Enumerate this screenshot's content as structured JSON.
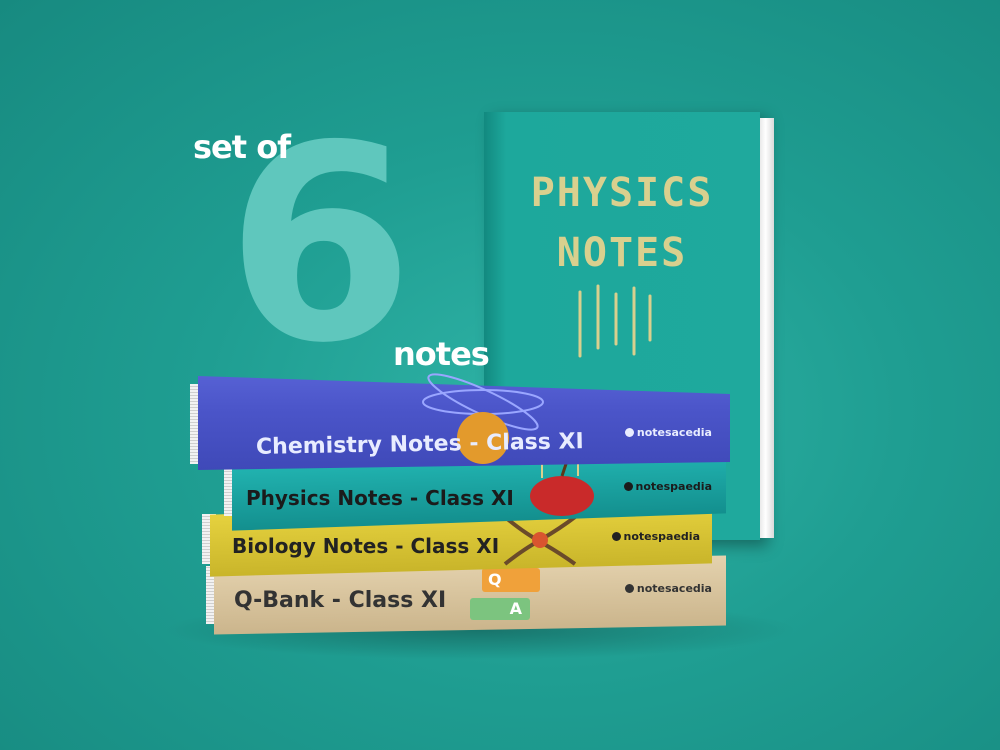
{
  "promo": {
    "prefix": "set of",
    "count": "6",
    "suffix": "notes"
  },
  "standing_book": {
    "title_line1": "PHYSICS",
    "title_line2": "NOTES",
    "cover_color": "#1fa99d"
  },
  "stack": [
    {
      "title": "Chemistry Notes - Class XI",
      "brand": "notesacedia",
      "cover_color": "#4a56c8"
    },
    {
      "title": "Physics Notes - Class XI",
      "brand": "notespaedia",
      "cover_color": "#1aa8a8"
    },
    {
      "title": "Biology Notes - Class XI",
      "brand": "notespaedia",
      "cover_color": "#d9c637"
    },
    {
      "title": "Q-Bank - Class XI",
      "brand": "notesacedia",
      "cover_color": "#dcc8a4"
    }
  ],
  "qa_badges": {
    "question": "Q",
    "answer": "A"
  }
}
